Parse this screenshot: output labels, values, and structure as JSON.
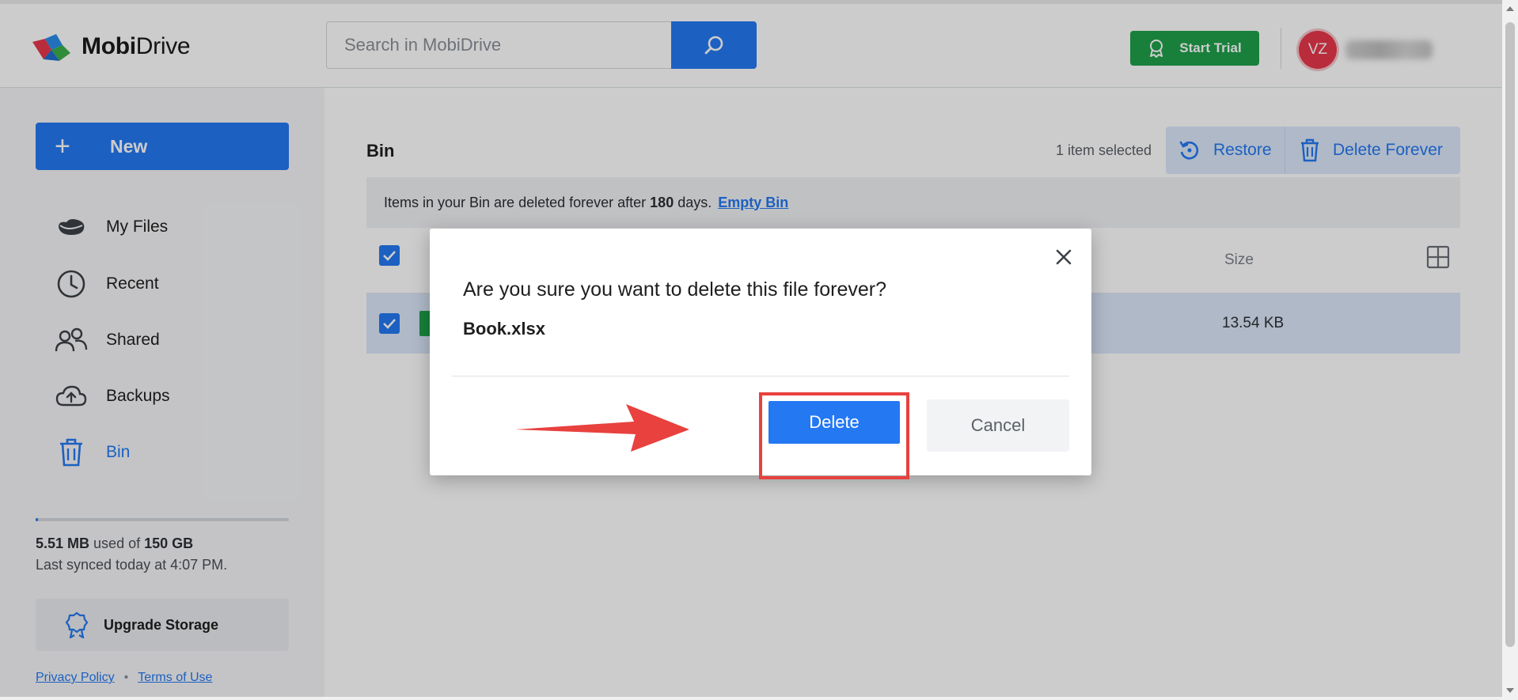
{
  "app": {
    "brand_bold": "Mobi",
    "brand_regular": "Drive"
  },
  "header": {
    "search_placeholder": "Search in MobiDrive",
    "trial_label": "Start Trial",
    "avatar_initials": "VZ"
  },
  "sidebar": {
    "new_label": "New",
    "items": [
      {
        "label": "My Files",
        "icon": "cloud-icon"
      },
      {
        "label": "Recent",
        "icon": "clock-icon"
      },
      {
        "label": "Shared",
        "icon": "users-icon"
      },
      {
        "label": "Backups",
        "icon": "cloud-upload-icon"
      },
      {
        "label": "Bin",
        "icon": "trash-icon",
        "active": true
      }
    ],
    "storage_used": "5.51 MB",
    "storage_used_of": "used of",
    "storage_total": "150 GB",
    "storage_used_fraction": 3.59e-05,
    "last_synced": "Last synced today at 4:07 PM.",
    "upgrade_label": "Upgrade Storage",
    "privacy_label": "Privacy Policy",
    "terms_label": "Terms of Use"
  },
  "main": {
    "title": "Bin",
    "selected_text": "1 item selected",
    "restore_label": "Restore",
    "delete_forever_label": "Delete Forever",
    "notice_pre": "Items in your Bin are deleted forever after",
    "notice_days": "180",
    "notice_post": "days.",
    "empty_bin_label": "Empty Bin",
    "size_header": "Size",
    "file_size": "13.54 KB"
  },
  "dialog": {
    "question": "Are you sure you want to delete this file forever?",
    "file_name": "Book.xlsx",
    "delete_label": "Delete",
    "cancel_label": "Cancel"
  },
  "colors": {
    "accent": "#2478f2",
    "trial_green": "#1fa04a",
    "avatar_red": "#e8384a",
    "highlight_red": "#e8413e"
  }
}
